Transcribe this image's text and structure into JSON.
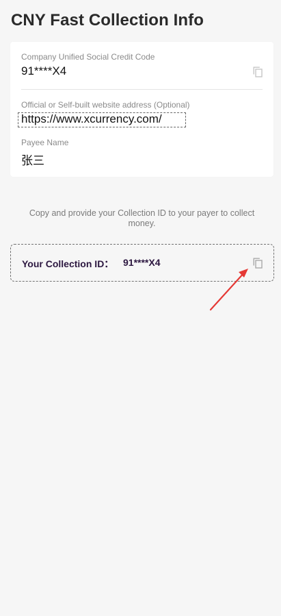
{
  "header": {
    "title": "CNY Fast Collection Info"
  },
  "card": {
    "company_label": "Company Unified Social Credit Code",
    "company_value": "91****X4",
    "website_label": "Official or Self-built website address (Optional)",
    "website_value": "https://www.xcurrency.com/",
    "payee_label": "Payee Name",
    "payee_value": "张三"
  },
  "collection": {
    "instruction": "Copy and provide your Collection ID to your payer to collect money.",
    "label": "Your Collection ID：",
    "value": "91****X4"
  },
  "icons": {
    "copy_company": "copy-icon",
    "copy_collection": "copy-icon",
    "annotation_arrow": "red-arrow-icon"
  },
  "colors": {
    "accent_text": "#2c1740",
    "annotation": "#e53935"
  }
}
